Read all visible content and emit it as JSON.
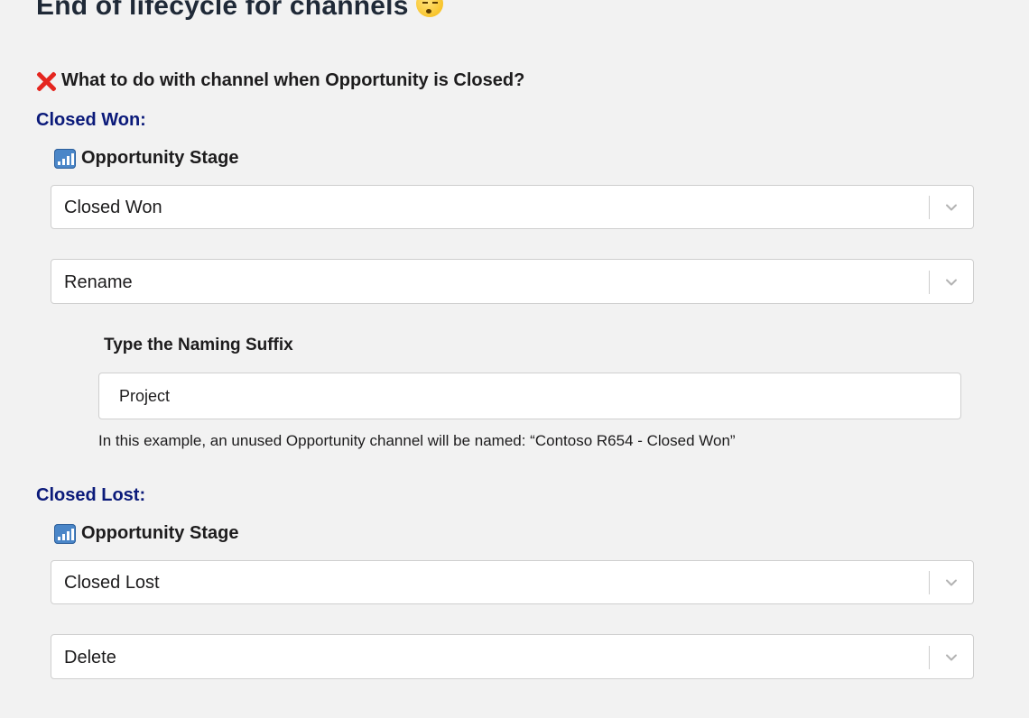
{
  "page": {
    "title": "End of lifecycle for channels",
    "title_emoji": "sleeping-face-icon"
  },
  "question": {
    "icon": "cross-mark-icon",
    "text": "What to do with channel when Opportunity is Closed?"
  },
  "closed_won": {
    "label": "Closed Won:",
    "stage_label": "Opportunity Stage",
    "stage_icon": "bar-chart-icon",
    "stage_value": "Closed Won",
    "action_value": "Rename",
    "suffix_label": "Type the Naming Suffix",
    "suffix_value": "Project",
    "hint": "In this example, an unused Opportunity channel will be named: “Contoso R654 - Closed Won”"
  },
  "closed_lost": {
    "label": "Closed Lost:",
    "stage_label": "Opportunity Stage",
    "stage_icon": "bar-chart-icon",
    "stage_value": "Closed Lost",
    "action_value": "Delete"
  },
  "colors": {
    "background": "#f2f2f2",
    "section_label": "#0b1a7a",
    "cross": "#e5261f"
  }
}
